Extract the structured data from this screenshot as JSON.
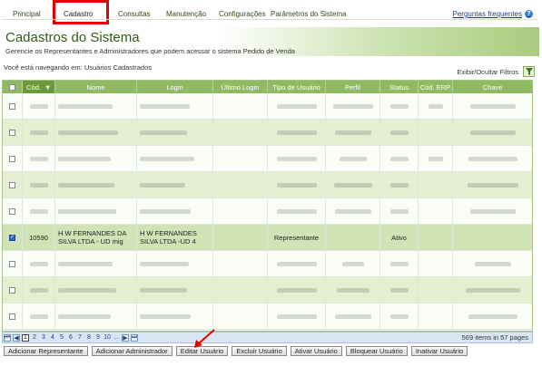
{
  "nav": {
    "items": [
      "Principal",
      "Cadastro",
      "Consultas",
      "Manutenção",
      "Configurações",
      "Parâmetros do Sistema"
    ],
    "active": "Cadastro",
    "faq_label": "Perguntas frequentes",
    "faq_icon": "help-icon"
  },
  "header": {
    "title": "Cadastros do Sistema",
    "subtitle": "Gerencie os Representantes e Administradores que podem acessar o sistema Pedido de Venda"
  },
  "breadcrumb": "Você está navegando em: Usuários Cadastrados",
  "filters": {
    "toggle_label": "Exibir/Ocultar Filtros",
    "icon": "funnel-icon"
  },
  "table": {
    "columns": [
      "Cód.",
      "Nome",
      "Login",
      "Último Login",
      "Tipo de Usuário",
      "Perfil",
      "Status",
      "Cód. ERP",
      "Chave"
    ],
    "selected_row": {
      "cod": "10590",
      "nome": "H W FERNANDES DA SILVA LTDA - UD mig",
      "login": "H W FERNANDES SILVA LTDA -UD 4",
      "ultimo_login": "",
      "tipo": "Representante",
      "perfil": "",
      "status": "Ativo",
      "cod_erp": "",
      "chave": ""
    }
  },
  "pager": {
    "pages": [
      "1",
      "2",
      "3",
      "4",
      "5",
      "6",
      "7",
      "8",
      "9",
      "10",
      "..."
    ],
    "current": "1",
    "info": "569 items in 57 pages"
  },
  "actions": [
    "Adicionar Representante",
    "Adicionar Administrador",
    "Editar Usuário",
    "Excluir Usuário",
    "Ativar Usuário",
    "Bloquear Usuário",
    "Inativar Usuário"
  ],
  "colors": {
    "accent": "#8fba62",
    "highlight": "#e20000",
    "title": "#2f5d10"
  }
}
